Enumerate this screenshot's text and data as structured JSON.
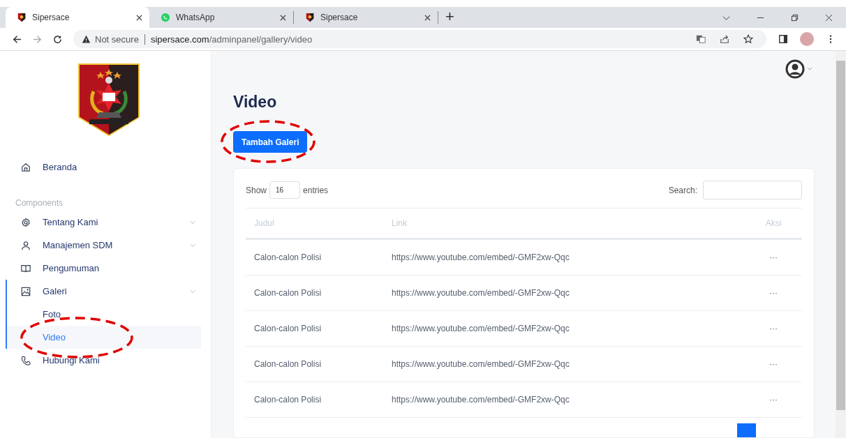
{
  "browser": {
    "tabs": [
      {
        "title": "Sipersace",
        "selected": true
      },
      {
        "title": "WhatsApp",
        "selected": false
      },
      {
        "title": "Sipersace",
        "selected": false
      }
    ],
    "new_tab": "+",
    "security": "Not secure",
    "url_host": "sipersace.com",
    "url_path": "/adminpanel/gallery/video"
  },
  "sidebar": {
    "home": {
      "label": "Beranda"
    },
    "section": "Components",
    "items": [
      {
        "label": "Tentang Kami",
        "submenu": true,
        "selected": false
      },
      {
        "label": "Manajemen SDM",
        "submenu": true,
        "selected": false
      },
      {
        "label": "Pengumuman",
        "submenu": false,
        "selected": false
      },
      {
        "label": "Galeri",
        "submenu": true,
        "selected": true,
        "children": [
          {
            "label": "Foto",
            "selected": false,
            "highlighted": false
          },
          {
            "label": "Video",
            "selected": true,
            "highlighted": true
          }
        ]
      },
      {
        "label": "Hubungi Kami",
        "submenu": false,
        "selected": false
      }
    ]
  },
  "page": {
    "title": "Video",
    "add_button": {
      "label": "Tambah Galeri",
      "highlighted": true
    },
    "show_label": "Show",
    "entries_value": "16",
    "entries_label": "entries",
    "search_label": "Search:",
    "table": {
      "columns": [
        "Judul",
        "Link",
        "Aksi"
      ],
      "rows": [
        {
          "judul": "Calon-calon Polisi",
          "link": "https://www.youtube.com/embed/-GMF2xw-Qqc",
          "aksi": "···"
        },
        {
          "judul": "Calon-calon Polisi",
          "link": "https://www.youtube.com/embed/-GMF2xw-Qqc",
          "aksi": "···"
        },
        {
          "judul": "Calon-calon Polisi",
          "link": "https://www.youtube.com/embed/-GMF2xw-Qqc",
          "aksi": "···"
        },
        {
          "judul": "Calon-calon Polisi",
          "link": "https://www.youtube.com/embed/-GMF2xw-Qqc",
          "aksi": "···"
        },
        {
          "judul": "Calon-calon Polisi",
          "link": "https://www.youtube.com/embed/-GMF2xw-Qqc",
          "aksi": "···"
        }
      ]
    }
  }
}
